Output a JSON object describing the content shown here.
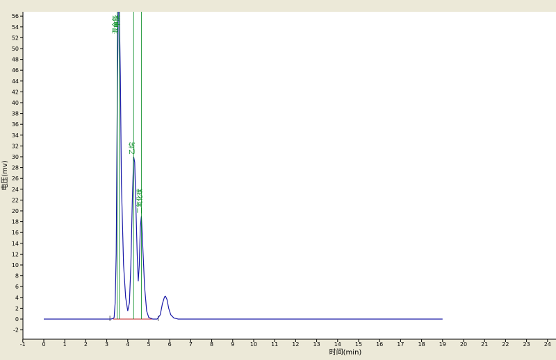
{
  "chart_data": {
    "type": "line",
    "title": "",
    "xlabel": "时间(min)",
    "ylabel": "电压(mv)",
    "xlim": [
      -1,
      24.5
    ],
    "ylim": [
      -3.5,
      56
    ],
    "x_ticks": [
      -1,
      0,
      1,
      2,
      3,
      4,
      5,
      6,
      7,
      8,
      9,
      10,
      11,
      12,
      13,
      14,
      15,
      16,
      17,
      18,
      19,
      20,
      21,
      22,
      23,
      24
    ],
    "y_ticks": [
      -2,
      0,
      2,
      4,
      6,
      8,
      10,
      12,
      14,
      16,
      18,
      20,
      22,
      24,
      26,
      28,
      30,
      32,
      34,
      36,
      38,
      40,
      42,
      44,
      46,
      48,
      50,
      52,
      54,
      56
    ],
    "grid": false,
    "series": [
      {
        "color": "#1a1aa8",
        "points": [
          [
            0,
            0
          ],
          [
            3.2,
            0
          ],
          [
            3.3,
            0.1
          ],
          [
            3.35,
            0.3
          ],
          [
            3.4,
            3
          ],
          [
            3.45,
            12
          ],
          [
            3.5,
            40
          ],
          [
            3.55,
            57
          ],
          [
            3.6,
            57
          ],
          [
            3.65,
            45
          ],
          [
            3.7,
            25
          ],
          [
            3.8,
            10
          ],
          [
            3.9,
            4
          ],
          [
            4.0,
            1.5
          ],
          [
            4.08,
            3
          ],
          [
            4.15,
            10
          ],
          [
            4.22,
            22
          ],
          [
            4.28,
            30
          ],
          [
            4.33,
            29
          ],
          [
            4.38,
            22
          ],
          [
            4.45,
            12
          ],
          [
            4.5,
            7
          ],
          [
            4.55,
            10
          ],
          [
            4.6,
            17
          ],
          [
            4.65,
            19
          ],
          [
            4.7,
            15
          ],
          [
            4.8,
            6
          ],
          [
            4.9,
            1.5
          ],
          [
            5.0,
            0.3
          ],
          [
            5.2,
            0
          ],
          [
            5.4,
            0
          ],
          [
            5.55,
            0.8
          ],
          [
            5.65,
            2.8
          ],
          [
            5.75,
            4.1
          ],
          [
            5.8,
            4.2
          ],
          [
            5.87,
            3.6
          ],
          [
            5.95,
            2
          ],
          [
            6.05,
            0.8
          ],
          [
            6.2,
            0.2
          ],
          [
            6.4,
            0
          ],
          [
            19,
            0
          ]
        ]
      }
    ],
    "peak_labels": [
      {
        "text": "混合气",
        "x": 3.5
      },
      {
        "text": "甲烷",
        "x": 3.6
      },
      {
        "text": "乙烷",
        "x": 4.28
      },
      {
        "text": "二氧化碳",
        "x": 4.65
      }
    ],
    "peak_marker_color": "#008a1e",
    "baseline_color": "#c02020"
  }
}
